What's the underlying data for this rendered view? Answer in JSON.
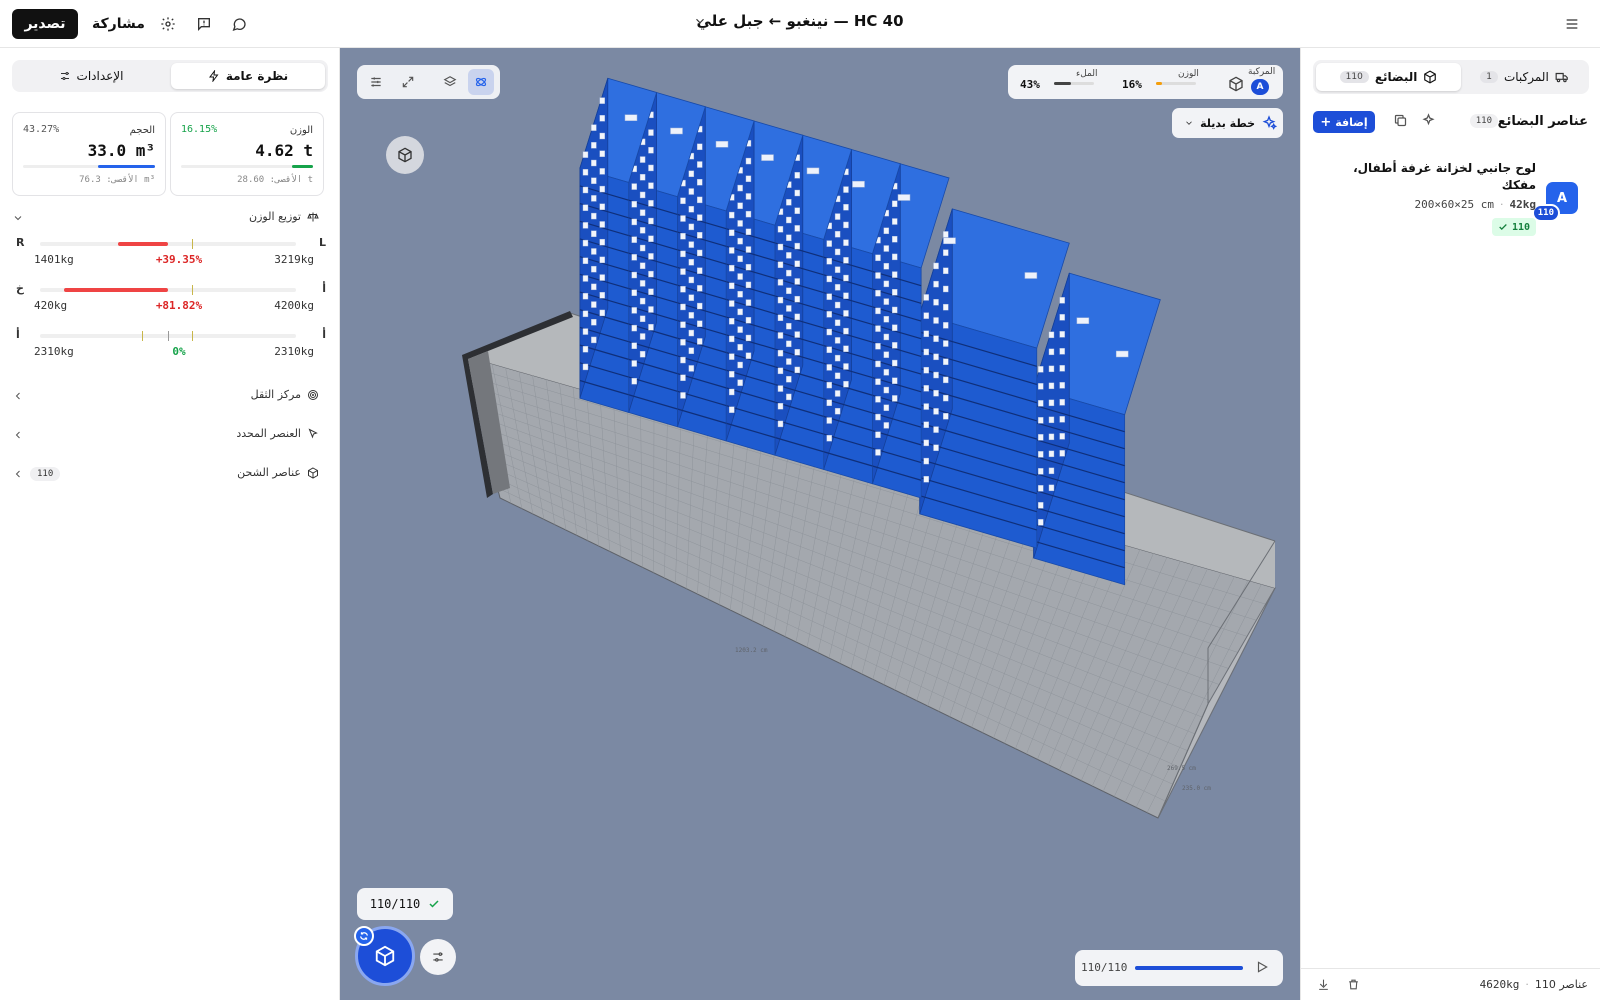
{
  "header": {
    "title": "نينغبو ← جبل علي — HC 40",
    "export_label": "تصدير",
    "share_label": "مشاركة"
  },
  "left_panel": {
    "tabs": [
      {
        "label": "نظرة عامة",
        "active": true
      },
      {
        "label": "الإعدادات",
        "active": false
      }
    ],
    "weight_card": {
      "label": "الوزن",
      "value": "4.62 t",
      "percent": "16.15%",
      "max_text": "الأقصى: 28.60 t",
      "fill_fraction": 0.1615,
      "color": "#16a34a"
    },
    "volume_card": {
      "label": "الحجم",
      "value": "33.0 m³",
      "percent": "43.27%",
      "max_text": "الأقصى: 76.3 m³",
      "fill_fraction": 0.4327,
      "color": "#2563eb"
    },
    "distribution": {
      "title": "توزيع الوزن",
      "rows": [
        {
          "end_left": "R",
          "end_right": "L",
          "left_value": "1401kg",
          "middle": "+39.35%",
          "right_value": "3219kg",
          "middle_color": "#dc2626"
        },
        {
          "end_left": "خ",
          "end_right": "أ",
          "left_value": "420kg",
          "middle": "+81.82%",
          "right_value": "4200kg",
          "middle_color": "#dc2626"
        },
        {
          "end_left": "أ",
          "end_right": "أ",
          "left_value": "2310kg",
          "middle": "0%",
          "right_value": "2310kg",
          "middle_color": "#16a34a"
        }
      ]
    },
    "center_of_gravity": "مركز الثقل",
    "selected_item": "العنصر المحدد",
    "shipment_items": {
      "label": "عناصر الشحن",
      "count": "110"
    }
  },
  "viewport": {
    "info": {
      "vehicle_label": "المركبة",
      "vehicle_badge": "A",
      "weight_label": "الوزن",
      "weight_value": "16%",
      "fill_label": "الملء",
      "fill_value": "43%"
    },
    "alt_plan_label": "خطة بديلة",
    "status": "110/110",
    "playback": {
      "text": "110/110",
      "progress": 1.0
    },
    "dim_labels": [
      "1203.2 cm",
      "269.5 cm",
      "235.0 cm"
    ]
  },
  "right_panel": {
    "tabs": [
      {
        "label": "المركبات",
        "count": "1",
        "active": false
      },
      {
        "label": "البضائع",
        "count": "110",
        "active": true
      }
    ],
    "section_title": "عناصر البضائع",
    "section_count": "110",
    "add_label": "إضافة",
    "cargo_item": {
      "letter": "A",
      "badge": "110",
      "name": "لوح جانبي لخزانة غرفة أطفال، مفكك",
      "weight": "42kg",
      "dims": "200×60×25 cm",
      "placed": "110"
    },
    "footer": {
      "items": "110 عناصر",
      "weight": "4620kg"
    }
  },
  "colors": {
    "accent": "#1d4ed8",
    "viewport_bg": "#7b89a3",
    "cargo_blue": "#1e5bd0",
    "danger": "#ef4444"
  }
}
